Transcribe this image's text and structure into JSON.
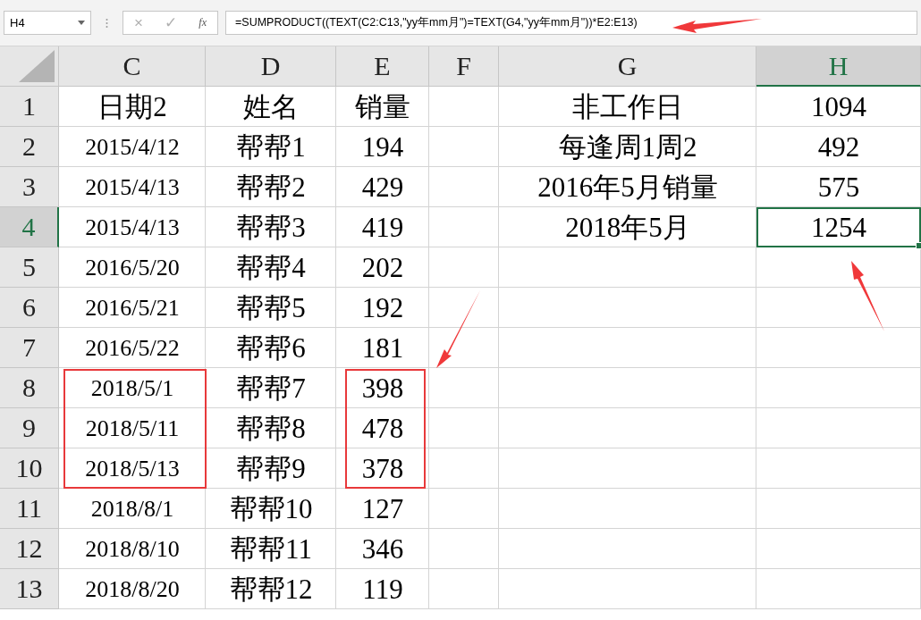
{
  "name_box": {
    "value": "H4"
  },
  "formula_bar": {
    "buttons": [
      "×",
      "✓",
      "fx"
    ],
    "formula": "=SUMPRODUCT((TEXT(C2:C13,\"yy年mm月\")=TEXT(G4,\"yy年mm月\"))*E2:E13)"
  },
  "columns": [
    {
      "label": "C",
      "selected": false
    },
    {
      "label": "D",
      "selected": false
    },
    {
      "label": "E",
      "selected": false
    },
    {
      "label": "F",
      "selected": false
    },
    {
      "label": "G",
      "selected": false
    },
    {
      "label": "H",
      "selected": true
    }
  ],
  "rows": [
    {
      "number": "1",
      "selected": false,
      "cells": {
        "C": "日期2",
        "D": "姓名",
        "E": "销量",
        "G": "非工作日",
        "H": "1094"
      }
    },
    {
      "number": "2",
      "selected": false,
      "cells": {
        "C": "2015/4/12",
        "D": "帮帮1",
        "E": "194",
        "G": "每逢周1周2",
        "H": "492"
      }
    },
    {
      "number": "3",
      "selected": false,
      "cells": {
        "C": "2015/4/13",
        "D": "帮帮2",
        "E": "429",
        "G": "2016年5月销量",
        "H": "575"
      }
    },
    {
      "number": "4",
      "selected": true,
      "cells": {
        "C": "2015/4/13",
        "D": "帮帮3",
        "E": "419",
        "G": "2018年5月",
        "H": "1254"
      }
    },
    {
      "number": "5",
      "selected": false,
      "cells": {
        "C": "2016/5/20",
        "D": "帮帮4",
        "E": "202"
      }
    },
    {
      "number": "6",
      "selected": false,
      "cells": {
        "C": "2016/5/21",
        "D": "帮帮5",
        "E": "192"
      }
    },
    {
      "number": "7",
      "selected": false,
      "cells": {
        "C": "2016/5/22",
        "D": "帮帮6",
        "E": "181"
      }
    },
    {
      "number": "8",
      "selected": false,
      "cells": {
        "C": "2018/5/1",
        "D": "帮帮7",
        "E": "398"
      }
    },
    {
      "number": "9",
      "selected": false,
      "cells": {
        "C": "2018/5/11",
        "D": "帮帮8",
        "E": "478"
      }
    },
    {
      "number": "10",
      "selected": false,
      "cells": {
        "C": "2018/5/13",
        "D": "帮帮9",
        "E": "378"
      }
    },
    {
      "number": "11",
      "selected": false,
      "cells": {
        "C": "2018/8/1",
        "D": "帮帮10",
        "E": "127"
      }
    },
    {
      "number": "12",
      "selected": false,
      "cells": {
        "C": "2018/8/10",
        "D": "帮帮11",
        "E": "346"
      }
    },
    {
      "number": "13",
      "selected": false,
      "cells": {
        "C": "2018/8/20",
        "D": "帮帮12",
        "E": "119"
      }
    }
  ]
}
